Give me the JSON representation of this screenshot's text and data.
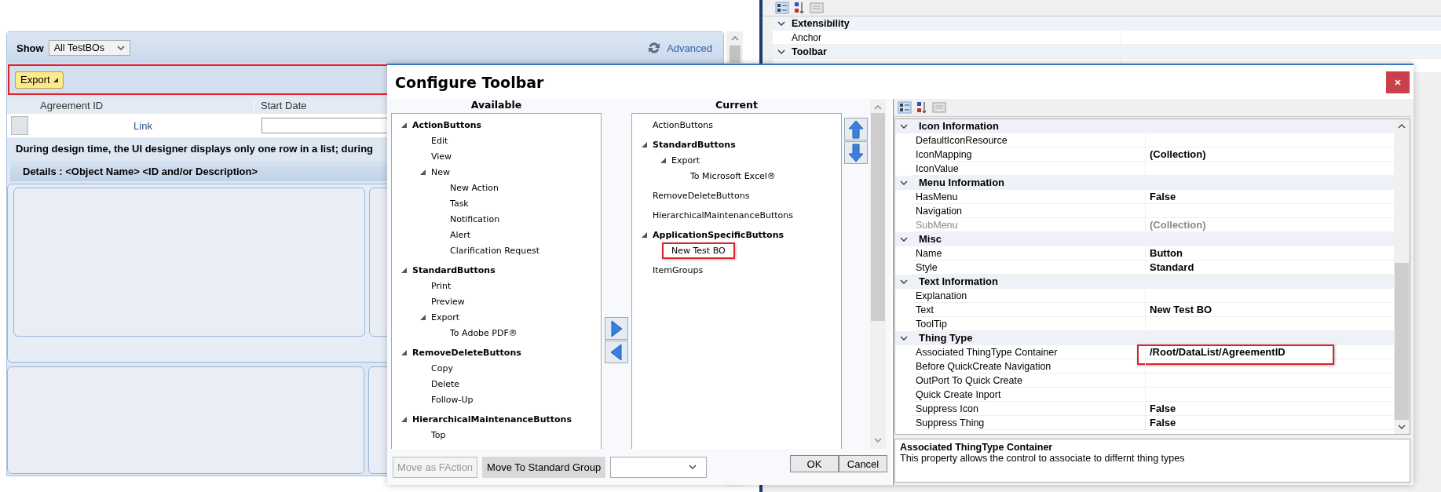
{
  "designer": {
    "show_label": "Show",
    "show_select": "All TestBOs",
    "advanced_link": "Advanced",
    "toolbar": {
      "highlighted": true,
      "buttons": [
        "Export"
      ]
    },
    "table": {
      "columns": [
        "Agreement ID",
        "Start Date"
      ],
      "rows": [
        {
          "link": "Link"
        }
      ]
    },
    "note": "During design time, the UI designer displays only one row in a list; during",
    "details_title": "Details : <Object Name> <ID and/or Description>"
  },
  "background_properties": {
    "categories": [
      {
        "name": "Extensibility",
        "expanded": true,
        "rows": [
          {
            "name": "Anchor"
          }
        ]
      },
      {
        "name": "Toolbar",
        "expanded": true
      }
    ]
  },
  "dialog": {
    "title": "Configure Toolbar",
    "available": {
      "header": "Available",
      "tree": [
        {
          "label": "ActionButtons",
          "expanded": true,
          "children": [
            {
              "label": "Edit"
            },
            {
              "label": "View"
            },
            {
              "label": "New",
              "expanded": true,
              "children": [
                {
                  "label": "New Action"
                },
                {
                  "label": "Task"
                },
                {
                  "label": "Notification"
                },
                {
                  "label": "Alert"
                },
                {
                  "label": "Clarification Request"
                }
              ]
            }
          ]
        },
        {
          "label": "StandardButtons",
          "expanded": true,
          "children": [
            {
              "label": "Print"
            },
            {
              "label": "Preview"
            },
            {
              "label": "Export",
              "expanded": true,
              "children": [
                {
                  "label": "To Adobe PDF®"
                }
              ]
            }
          ]
        },
        {
          "label": "RemoveDeleteButtons",
          "expanded": true,
          "children": [
            {
              "label": "Copy"
            },
            {
              "label": "Delete"
            },
            {
              "label": "Follow-Up"
            }
          ]
        },
        {
          "label": "HierarchicalMaintenanceButtons",
          "expanded": true,
          "children": [
            {
              "label": "Top"
            }
          ]
        }
      ]
    },
    "current": {
      "header": "Current",
      "tree": [
        {
          "label": "ActionButtons"
        },
        {
          "label": "StandardButtons",
          "expanded": true,
          "children": [
            {
              "label": "Export",
              "expanded": true,
              "children": [
                {
                  "label": "To Microsoft Excel®"
                }
              ]
            }
          ]
        },
        {
          "label": "RemoveDeleteButtons"
        },
        {
          "label": "HierarchicalMaintenanceButtons"
        },
        {
          "label": "ApplicationSpecificButtons",
          "expanded": true,
          "children": [
            {
              "label": "New Test BO",
              "highlighted": true
            }
          ]
        },
        {
          "label": "ItemGroups"
        }
      ]
    },
    "buttons": [
      {
        "label": "Move as FAction",
        "disabled": true
      },
      {
        "label": "Move To Standard Group",
        "disabled": false
      }
    ],
    "actions": [
      "OK",
      "Cancel"
    ],
    "properties": {
      "categories": [
        {
          "name": "Icon Information",
          "expanded": true,
          "rows": [
            {
              "name": "DefaultIconResource"
            },
            {
              "name": "IconMapping",
              "value": "(Collection)"
            },
            {
              "name": "IconValue"
            }
          ]
        },
        {
          "name": "Menu Information",
          "expanded": true,
          "rows": [
            {
              "name": "HasMenu",
              "value": "False"
            },
            {
              "name": "Navigation"
            },
            {
              "name": "SubMenu",
              "value": "(Collection)",
              "disabled": true
            }
          ]
        },
        {
          "name": "Misc",
          "expanded": true,
          "rows": [
            {
              "name": "Name",
              "value": "Button"
            },
            {
              "name": "Style",
              "value": "Standard"
            }
          ]
        },
        {
          "name": "Text Information",
          "expanded": true,
          "rows": [
            {
              "name": "Explanation"
            },
            {
              "name": "Text",
              "value": "New Test BO"
            },
            {
              "name": "ToolTip"
            }
          ]
        },
        {
          "name": "Thing Type",
          "expanded": true,
          "rows": [
            {
              "name": "Associated ThingType Container",
              "value": "/Root/DataList/AgreementID",
              "highlighted": true
            },
            {
              "name": "Before QuickCreate Navigation"
            },
            {
              "name": "OutPort To Quick Create"
            },
            {
              "name": "Quick Create Inport"
            },
            {
              "name": "Suppress Icon",
              "value": "False"
            },
            {
              "name": "Suppress Thing",
              "value": "False"
            }
          ]
        }
      ]
    },
    "description": {
      "title": "Associated ThingType Container",
      "text": "This property allows the control to associate to differnt thing types"
    }
  }
}
